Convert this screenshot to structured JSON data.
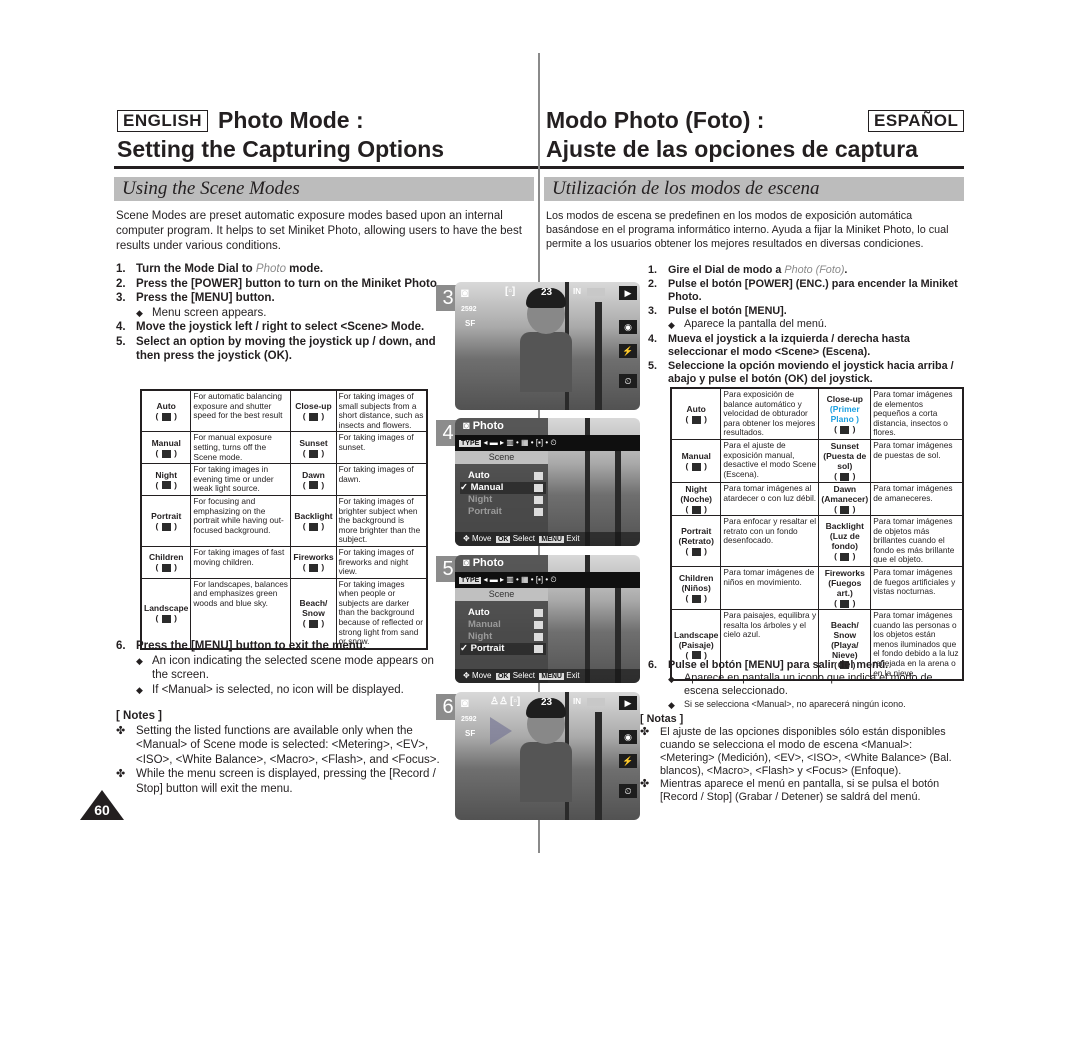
{
  "english": {
    "lang_label": "ENGLISH",
    "title_line1": "Photo Mode :",
    "title_line2": "Setting the Capturing Options",
    "section": "Using the Scene Modes",
    "intro": "Scene Modes are preset automatic exposure modes based upon an internal computer program. It helps to set Miniket Photo, allowing users to have the best results under various conditions.",
    "steps": [
      {
        "num": "1.",
        "pre": "Turn the Mode Dial to ",
        "photo": "Photo",
        "post": " mode."
      },
      {
        "num": "2.",
        "text": "Press the [POWER] button to turn on the Miniket Photo."
      },
      {
        "num": "3.",
        "text": "Press the [MENU] button.",
        "bullet": "Menu screen appears."
      },
      {
        "num": "4.",
        "text": "Move the joystick left / right to select <Scene> Mode."
      },
      {
        "num": "5.",
        "text": "Select an option by moving the joystick up / down, and then press the joystick (OK)."
      }
    ],
    "table": [
      {
        "mode": "Auto",
        "desc": "For automatic balancing exposure and shutter speed for the best result",
        "mode2": "Close-up",
        "desc2": "For taking images of small subjects from a short distance, such as insects and flowers."
      },
      {
        "mode": "Manual",
        "desc": "For manual exposure setting, turns off the Scene mode.",
        "mode2": "Sunset",
        "desc2": "For taking images of sunset."
      },
      {
        "mode": "Night",
        "desc": "For taking images in evening time or under weak light source.",
        "mode2": "Dawn",
        "desc2": "For taking images of dawn."
      },
      {
        "mode": "Portrait",
        "desc": "For focusing and emphasizing on the portrait while having out-focused background.",
        "mode2": "Backlight",
        "desc2": "For taking images of brighter subject when the background is more brighter than the subject."
      },
      {
        "mode": "Children",
        "desc": "For taking images of fast moving children.",
        "mode2": "Fireworks",
        "desc2": "For taking images of fireworks and night view."
      },
      {
        "mode": "Landscape",
        "desc": "For landscapes, balances and emphasizes green woods and blue sky.",
        "mode2": "Beach/ Snow",
        "desc2": "For taking images when people or subjects are darker than the background because of reflected or strong light from sand or snow."
      }
    ],
    "step6": {
      "num": "6.",
      "text": "Press the [MENU] button to exit the menu.",
      "bullets": [
        "An icon indicating the selected scene mode appears on the screen.",
        "If <Manual> is selected, no icon will be displayed."
      ]
    },
    "notes_title": "[ Notes ]",
    "notes": [
      "Setting the listed functions are available only when the <Manual> of Scene mode is selected: <Metering>, <EV>, <ISO>, <White Balance>, <Macro>, <Flash>, and <Focus>.",
      "While the menu screen is displayed, pressing the [Record / Stop] button will exit the menu."
    ],
    "page_number": "60"
  },
  "espanol": {
    "lang_label": "ESPAÑOL",
    "title_line1": "Modo Photo (Foto) :",
    "title_line2": "Ajuste de las opciones de captura",
    "section": "Utilización de los modos de escena",
    "intro": "Los modos de escena se predefinen en los modos de exposición automática basándose en el programa informático interno. Ayuda a fijar la Miniket Photo, lo cual permite a los usuarios obtener los mejores resultados en diversas condiciones.",
    "steps": [
      {
        "num": "1.",
        "pre": "Gire el Dial de modo a ",
        "photo": "Photo (Foto)",
        "post": "."
      },
      {
        "num": "2.",
        "text": "Pulse el botón [POWER] (ENC.) para encender la Miniket Photo."
      },
      {
        "num": "3.",
        "text": "Pulse el botón [MENU].",
        "bullet": "Aparece la pantalla del menú."
      },
      {
        "num": "4.",
        "text": "Mueva el joystick a la izquierda / derecha hasta seleccionar el modo <Scene> (Escena)."
      },
      {
        "num": "5.",
        "text": "Seleccione la opción moviendo el joystick hacia arriba / abajo y pulse el botón (OK) del joystick."
      }
    ],
    "table": [
      {
        "mode": "Auto",
        "desc": "Para exposición de balance automático y velocidad de obturador para obtener los mejores resultados.",
        "mode2": "Close-up",
        "mode2_sub": "(Primer Plano )",
        "desc2": "Para tomar imágenes de elementos pequeños a corta distancia, insectos o flores."
      },
      {
        "mode": "Manual",
        "desc": "Para el ajuste de exposición manual, desactive el modo Scene (Escena).",
        "mode2": "Sunset",
        "mode2_sub": "(Puesta de sol)",
        "desc2": "Para tomar imágenes de puestas de sol."
      },
      {
        "mode": "Night (Noche)",
        "desc": "Para tomar imágenes al atardecer o con luz débil.",
        "mode2": "Dawn",
        "mode2_sub": "(Amanecer)",
        "desc2": "Para tomar imágenes de amaneceres."
      },
      {
        "mode": "Portrait (Retrato)",
        "desc": "Para enfocar y resaltar el retrato con un fondo desenfocado.",
        "mode2": "Backlight",
        "mode2_sub": "(Luz de fondo)",
        "desc2": "Para tomar imágenes de objetos más brillantes cuando el fondo es más brillante que el objeto."
      },
      {
        "mode": "Children (Niños)",
        "desc": "Para tomar imágenes de niños en movimiento.",
        "mode2": "Fireworks",
        "mode2_sub": "(Fuegos art.)",
        "desc2": "Para tomar imágenes de fuegos artificiales y vistas nocturnas."
      },
      {
        "mode": "Landscape (Paisaje)",
        "desc": "Para paisajes, equilibra y resalta los árboles y el cielo azul.",
        "mode2": "Beach/ Snow",
        "mode2_sub": "(Playa/ Nieve)",
        "desc2": "Para tomar imágenes cuando las personas o los objetos están menos iluminados que el fondo debido a la luz reflejada en la arena o en la nieve."
      }
    ],
    "step6": {
      "num": "6.",
      "text": "Pulse el botón [MENU] para salir del menú.",
      "bullets": [
        "Aparece en pantalla un icono que indica el modo de escena seleccionado.",
        "Si se selecciona <Manual>, no aparecerá ningún icono."
      ]
    },
    "notes_title": "[ Notas ]",
    "notes": [
      "El ajuste de las opciones disponibles sólo están disponibles cuando se selecciona el modo de escena <Manual>: <Metering> (Medición), <EV>, <ISO>, <White Balance> (Bal. blancos), <Macro>, <Flash> y <Focus> (Enfoque).",
      "Mientras aparece el menú en pantalla, si se pulsa el botón [Record / Stop] (Grabar / Detener) se saldrá del menú."
    ]
  },
  "screens": [
    {
      "number": "3",
      "shots_remaining": "23",
      "memory": "IN",
      "resolution": "2592",
      "quality": "SF"
    },
    {
      "number": "4",
      "menu_title": "Photo",
      "type_label": "TYPE",
      "tab": "Scene",
      "items": [
        "Auto",
        "Manual",
        "Night",
        "Portrait"
      ],
      "selected": "Manual",
      "footer_move": "Move",
      "footer_ok": "OK",
      "footer_select": "Select",
      "footer_menu": "MENU",
      "footer_exit": "Exit"
    },
    {
      "number": "5",
      "menu_title": "Photo",
      "type_label": "TYPE",
      "tab": "Scene",
      "items": [
        "Auto",
        "Manual",
        "Night",
        "Portrait"
      ],
      "selected": "Portrait",
      "footer_move": "Move",
      "footer_ok": "OK",
      "footer_select": "Select",
      "footer_menu": "MENU",
      "footer_exit": "Exit"
    },
    {
      "number": "6",
      "shots_remaining": "23",
      "memory": "IN",
      "resolution": "2592",
      "quality": "SF"
    }
  ],
  "icons": {
    "bullet": "◆",
    "note": "✤",
    "check": "✓",
    "camera": "camera-icon"
  },
  "colors": {
    "text": "#231f20",
    "section_bar": "#bcbcbc",
    "accent_blue": "#1ca0e0",
    "photo_word": "#8a8a8a"
  }
}
